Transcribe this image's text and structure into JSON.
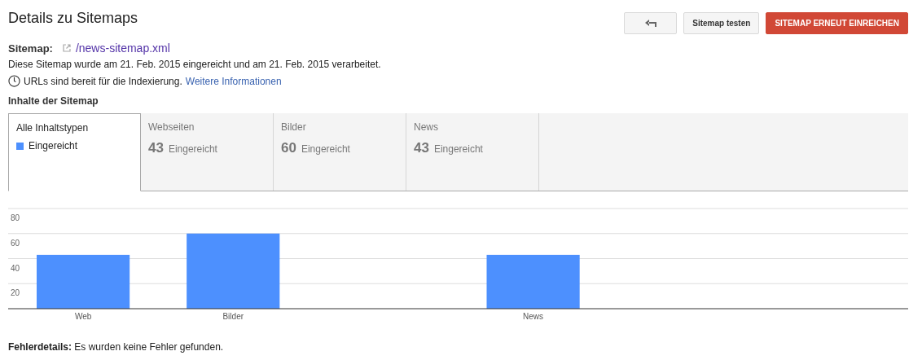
{
  "header": {
    "title": "Details zu Sitemaps",
    "buttons": [
      {
        "kind": "back"
      },
      {
        "kind": "plain",
        "label": "Sitemap testen"
      },
      {
        "kind": "primary",
        "label": "SITEMAP ERNEUT EINREICHEN"
      }
    ]
  },
  "sitemap": {
    "label": "Sitemap:",
    "link": "/news-sitemap.xml",
    "info": "Diese Sitemap wurde am 21. Feb. 2015 eingereicht und am 21. Feb. 2015 verarbeitet.",
    "status": "URLs sind bereit für die Indexierung.",
    "status_link": "Weitere Informationen"
  },
  "contents": {
    "heading": "Inhalte der Sitemap",
    "tabs": [
      {
        "label": "Alle Inhaltstypen",
        "legend": "Eingereicht",
        "color": "#4d90fe",
        "selected": true
      },
      {
        "label": "Webseiten",
        "count": "43",
        "unit": "Eingereicht",
        "selected": false
      },
      {
        "label": "Bilder",
        "count": "60",
        "unit": "Eingereicht",
        "selected": false
      },
      {
        "label": "News",
        "count": "43",
        "unit": "Eingereicht",
        "selected": false
      }
    ],
    "chart_data": {
      "type": "bar",
      "categories": [
        "Web",
        "Bilder",
        null,
        "News",
        null,
        null
      ],
      "values": [
        43,
        60,
        null,
        43,
        null,
        null
      ],
      "ylim": [
        0,
        80
      ],
      "yticks": [
        20,
        40,
        60,
        80
      ],
      "grid": true
    }
  },
  "errors": {
    "label": "Fehlerdetails:",
    "text": "Es wurden keine Fehler gefunden."
  }
}
